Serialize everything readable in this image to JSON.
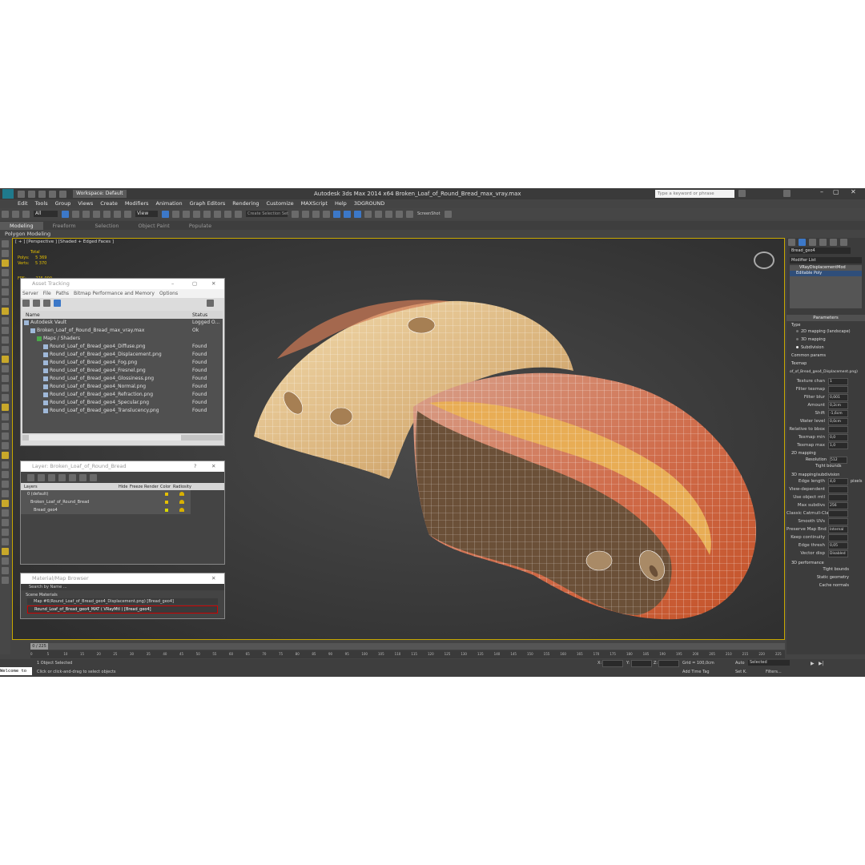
{
  "titlebar": {
    "workspace": "Workspace: Default",
    "title": "Autodesk 3ds Max  2014 x64     Broken_Loaf_of_Round_Bread_max_vray.max",
    "search_placeholder": "Type a keyword or phrase"
  },
  "menu": [
    "Edit",
    "Tools",
    "Group",
    "Views",
    "Create",
    "Modifiers",
    "Animation",
    "Graph Editors",
    "Rendering",
    "Customize",
    "MAXScript",
    "Help",
    "3DGROUND"
  ],
  "toolbar": {
    "filter": "All",
    "view": "View",
    "selection_set": "Create Selection Set",
    "screenshot": "ScreenShot"
  },
  "ribbon": {
    "tabs": [
      "Modeling",
      "Freeform",
      "Selection",
      "Object Paint",
      "Populate"
    ],
    "subtitle": "Polygon Modeling"
  },
  "viewport": {
    "label": "[ + ] [Perspective ] [Shaded + Edged Faces ]",
    "stats": {
      "total": "Total",
      "polys_label": "Polys:",
      "polys": "5 369",
      "verts_label": "Verts:",
      "verts": "5 370",
      "fps_label": "FPS:",
      "fps": "225,000"
    }
  },
  "asset_tracking": {
    "title": "Asset Tracking",
    "menu": [
      "Server",
      "File",
      "Paths",
      "Bitmap Performance and Memory",
      "Options"
    ],
    "col_name": "Name",
    "col_status": "Status",
    "rows": [
      {
        "name": "Autodesk Vault",
        "status": "Logged O..."
      },
      {
        "name": "Broken_Loaf_of_Round_Bread_max_vray.max",
        "status": "Ok"
      },
      {
        "name": "Maps / Shaders",
        "status": ""
      },
      {
        "name": "Round_Loaf_of_Bread_geo4_Diffuse.png",
        "status": "Found"
      },
      {
        "name": "Round_Loaf_of_Bread_geo4_Displacement.png",
        "status": "Found"
      },
      {
        "name": "Round_Loaf_of_Bread_geo4_Fog.png",
        "status": "Found"
      },
      {
        "name": "Round_Loaf_of_Bread_geo4_Fresnel.png",
        "status": "Found"
      },
      {
        "name": "Round_Loaf_of_Bread_geo4_Glossiness.png",
        "status": "Found"
      },
      {
        "name": "Round_Loaf_of_Bread_geo4_Normal.png",
        "status": "Found"
      },
      {
        "name": "Round_Loaf_of_Bread_geo4_Refraction.png",
        "status": "Found"
      },
      {
        "name": "Round_Loaf_of_Bread_geo4_Specular.png",
        "status": "Found"
      },
      {
        "name": "Round_Loaf_of_Bread_geo4_Translucency.png",
        "status": "Found"
      }
    ]
  },
  "layer_panel": {
    "title": "Layer: Broken_Loaf_of_Round_Bread",
    "cols": [
      "Layers",
      "Hide",
      "Freeze",
      "Render",
      "Color",
      "Radiosity"
    ],
    "rows": [
      "0 (default)",
      "Broken_Loaf_of_Round_Bread",
      "Bread_geo4"
    ]
  },
  "material_browser": {
    "title": "Material/Map Browser",
    "search": "Search by Name ...",
    "section": "Scene Materials",
    "items": [
      "Map #6(Round_Loaf_of_Bread_geo4_Displacement.png) [Bread_geo4]",
      "Round_Loaf_of_Bread_geo4_MAT ( VRayMtl ) [Bread_geo4]"
    ]
  },
  "command_panel": {
    "object_name": "Bread_geo4",
    "modifier_list": "Modifier List",
    "stack": [
      "VRayDisplacementMod",
      "Editable Poly"
    ],
    "parameters": "Parameters",
    "type_label": "Type",
    "types": [
      "2D mapping (landscape)",
      "3D mapping",
      "Subdivision"
    ],
    "common": "Common params",
    "texmap": "Texmap",
    "texmap_value": "of_of_Bread_geo4_Displacement.png)",
    "fields": [
      {
        "label": "Texture chan",
        "value": "1"
      },
      {
        "label": "Filter texmap",
        "value": ""
      },
      {
        "label": "Filter blur",
        "value": "0,001"
      },
      {
        "label": "Amount",
        "value": "0,2cm"
      },
      {
        "label": "Shift",
        "value": "-1,6cm"
      },
      {
        "label": "Water level",
        "value": "0,0cm"
      },
      {
        "label": "Relative to bbox",
        "value": ""
      },
      {
        "label": "Texmap min",
        "value": "0,0"
      },
      {
        "label": "Texmap max",
        "value": "1,0"
      }
    ],
    "mapping2d": "2D mapping",
    "resolution": "Resolution",
    "resolution_value": "512",
    "tight": "Tight bounds",
    "sub_title": "3D mapping/subdivision",
    "sub_fields": [
      {
        "label": "Edge length",
        "value": "4,0",
        "suffix": "pixels"
      },
      {
        "label": "View-dependent",
        "value": ""
      },
      {
        "label": "Use object mtl",
        "value": ""
      },
      {
        "label": "Max subdivs",
        "value": "256"
      },
      {
        "label": "Classic Catmull-Clark",
        "value": ""
      },
      {
        "label": "Smooth UVs",
        "value": ""
      },
      {
        "label": "Preserve Map Bnd",
        "value": "Internal"
      },
      {
        "label": "Keep continuity",
        "value": ""
      },
      {
        "label": "Edge thresh",
        "value": "0,05"
      },
      {
        "label": "Vector disp",
        "value": "Disabled"
      }
    ],
    "perf": "3D performance",
    "perf_fields": [
      "Tight bounds",
      "Static geometry",
      "Cache normals"
    ]
  },
  "timeline": {
    "frame": "0 / 225",
    "ticks": [
      "0",
      "5",
      "10",
      "15",
      "20",
      "25",
      "30",
      "35",
      "40",
      "45",
      "50",
      "55",
      "60",
      "65",
      "70",
      "75",
      "80",
      "85",
      "90",
      "95",
      "100",
      "105",
      "110",
      "115",
      "120",
      "125",
      "130",
      "135",
      "140",
      "145",
      "150",
      "155",
      "160",
      "165",
      "170",
      "175",
      "180",
      "185",
      "190",
      "195",
      "200",
      "205",
      "210",
      "215",
      "220",
      "225"
    ]
  },
  "status": {
    "welcome": "Welcome to",
    "selected": "1 Object Selected",
    "hint": "Click or click-and-drag to select objects",
    "x": "X:",
    "y": "Y:",
    "z": "Z:",
    "grid": "Grid = 100,0cm",
    "add_time_tag": "Add Time Tag",
    "auto": "Auto",
    "set_k": "Set K.",
    "selected_dd": "Selected",
    "filters": "Filters..."
  },
  "colors": {
    "app_bg": "#444444",
    "viewport_bg": "#3a3a3a",
    "accent": "#3c78c8",
    "bread_crust": "#c9643f",
    "bread_crumb": "#e2b67a"
  }
}
